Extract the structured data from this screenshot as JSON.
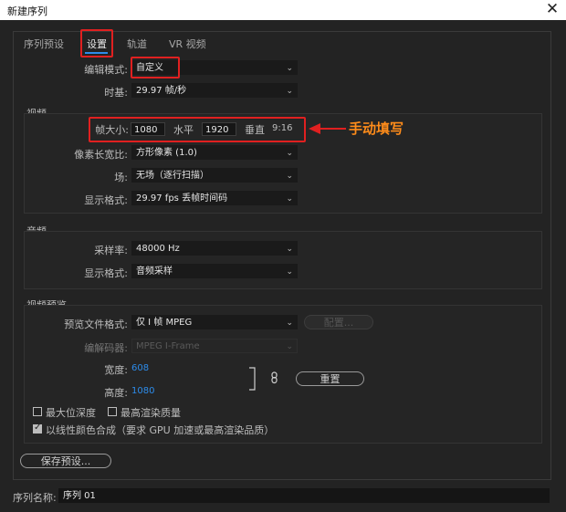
{
  "window": {
    "title": "新建序列",
    "close_symbol": "✕"
  },
  "tabs": [
    {
      "label": "序列预设"
    },
    {
      "label": "设置"
    },
    {
      "label": "轨道"
    },
    {
      "label": "VR 视频"
    }
  ],
  "settings": {
    "edit_mode": {
      "label": "编辑模式:",
      "value": "自定义"
    },
    "timebase": {
      "label": "时基:",
      "value": "29.97  帧/秒"
    }
  },
  "video": {
    "section_label": "视频",
    "frame_size": {
      "label": "帧大小:",
      "width_value": "1080",
      "horizontal_label": "水平",
      "height_value": "1920",
      "vertical_label": "垂直",
      "aspect": "9:16"
    },
    "pixel_aspect": {
      "label": "像素长宽比:",
      "value": "方形像素 (1.0)"
    },
    "field": {
      "label": "场:",
      "value": "无场（逐行扫描）"
    },
    "display_format": {
      "label": "显示格式:",
      "value": "29.97 fps 丢帧时间码"
    }
  },
  "annotation": {
    "text": "手动填写",
    "color": "#ff8c1a"
  },
  "audio": {
    "section_label": "音频",
    "sample_rate": {
      "label": "采样率:",
      "value": "48000 Hz"
    },
    "display_format": {
      "label": "显示格式:",
      "value": "音频采样"
    }
  },
  "video_preview": {
    "section_label": "视频预览",
    "preview_format": {
      "label": "预览文件格式:",
      "value": "仅 I 帧 MPEG"
    },
    "configure_button": "配置...",
    "codec": {
      "label": "编解码器:",
      "value": "MPEG I-Frame"
    },
    "width": {
      "label": "宽度:",
      "value": "608"
    },
    "height": {
      "label": "高度:",
      "value": "1080"
    },
    "reset_button": "重置",
    "link_icon": "link-icon"
  },
  "checkboxes": {
    "max_bit_depth": {
      "label": "最大位深度",
      "checked": false
    },
    "max_render_quality": {
      "label": "最高渲染质量",
      "checked": false
    },
    "linear_color": {
      "label": "以线性颜色合成（要求 GPU 加速或最高渲染品质）",
      "checked": true
    }
  },
  "save_preset_button": "保存预设...",
  "sequence_name": {
    "label": "序列名称:",
    "value": "序列 01"
  },
  "colors": {
    "accent_blue": "#2d8ceb",
    "highlight_red": "#e02020",
    "annotation_orange": "#ff8c1a"
  }
}
